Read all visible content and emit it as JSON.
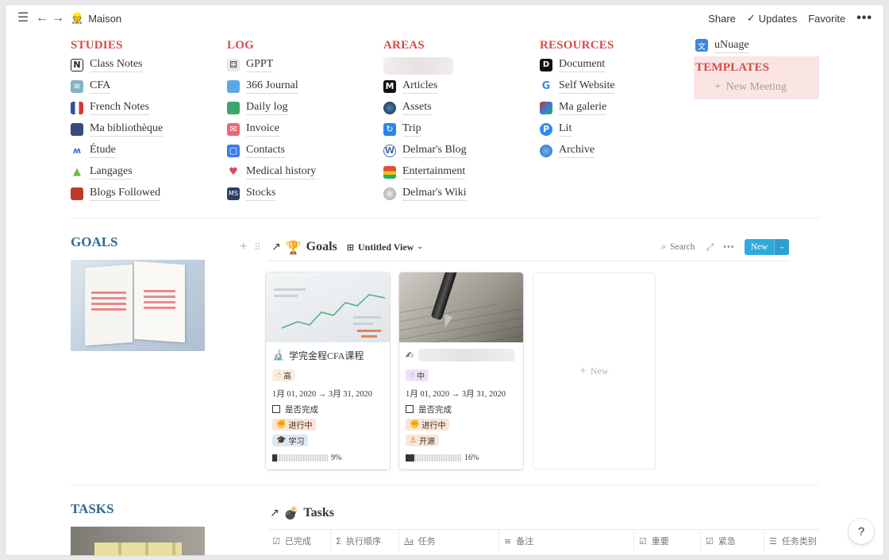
{
  "topbar": {
    "page_title": "Maison",
    "share": "Share",
    "updates": "Updates",
    "favorite": "Favorite"
  },
  "nav": {
    "studies": {
      "title": "STUDIES",
      "items": [
        "Class Notes",
        "CFA",
        "French Notes",
        "Ma bibliothèque",
        "Étude",
        "Langages",
        "Blogs Followed"
      ]
    },
    "log": {
      "title": "LOG",
      "items": [
        "GPPT",
        "366 Journal",
        "Daily log",
        "Invoice",
        "Contacts",
        "Medical history",
        "Stocks"
      ]
    },
    "areas": {
      "title": "AREAS",
      "items": [
        "Articles",
        "Assets",
        "Trip",
        "Delmar's Blog",
        "Entertainment",
        "Delmar's Wiki"
      ]
    },
    "resources": {
      "title": "RESOURCES",
      "items": [
        "Document",
        "Self Website",
        "Ma galerie",
        "Lit",
        "Archive"
      ]
    },
    "extra": {
      "link": "uNuage",
      "templates_title": "TEMPLATES",
      "new_meeting": "New Meeting"
    }
  },
  "goals": {
    "heading": "GOALS",
    "db_title": "Goals",
    "view_name": "Untitled View",
    "search": "Search",
    "new_button": "New",
    "new_card": "New",
    "cards": [
      {
        "title": "学完金程CFA课程",
        "priority": "高",
        "dates": "1月 01, 2020 → 3月 31, 2020",
        "done_label": "是否完成",
        "status": "进行中",
        "category": "学习",
        "progress": "9%",
        "progress_value": 0.09
      },
      {
        "title": "",
        "priority": "中",
        "dates": "1月 01, 2020 → 3月 31, 2020",
        "done_label": "是否完成",
        "status": "进行中",
        "category": "开源",
        "progress": "16%",
        "progress_value": 0.16
      }
    ]
  },
  "tasks": {
    "heading": "TASKS",
    "db_title": "Tasks",
    "columns": [
      "已完成",
      "执行顺序",
      "任务",
      "备注",
      "重要",
      "紧急",
      "任务类别"
    ]
  },
  "help": "?",
  "colors": {
    "category_red": "#d44c47",
    "section_blue": "#2d6a8f",
    "new_button_blue": "#2eaadc",
    "templates_bg": "#fbe4e4"
  }
}
